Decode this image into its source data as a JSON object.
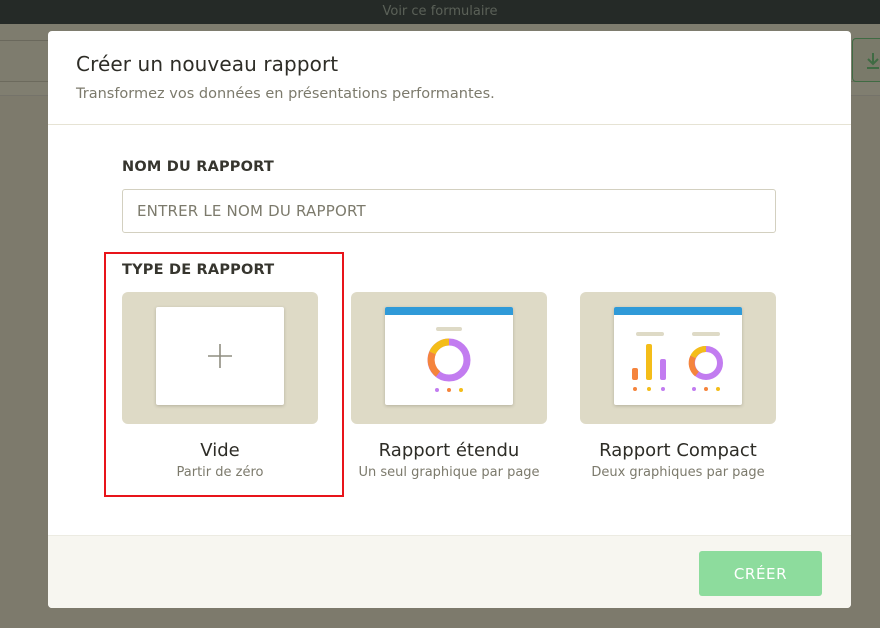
{
  "background": {
    "topbar_text": "Voir ce formulaire"
  },
  "modal": {
    "title": "Créer un nouveau rapport",
    "subtitle": "Transformez vos données en présentations performantes.",
    "name_label": "NOM DU RAPPORT",
    "name_input": {
      "value": "",
      "placeholder": "ENTRER LE NOM DU RAPPORT"
    },
    "type_label": "TYPE DE RAPPORT",
    "report_types": [
      {
        "name": "Vide",
        "description": "Partir de zéro",
        "icon": "plus-icon",
        "selected": true
      },
      {
        "name": "Rapport étendu",
        "description": "Un seul graphique par page",
        "icon": "single-chart-page-icon",
        "selected": false
      },
      {
        "name": "Rapport Compact",
        "description": "Deux graphiques par page",
        "icon": "two-charts-page-icon",
        "selected": false
      }
    ],
    "create_button": "CRÉER"
  },
  "colors": {
    "accent_green": "#8ddc9d",
    "thumbnail_bg": "#dedac6",
    "sheet_header_blue": "#2f9ad8",
    "chart_purple": "#c27cf0",
    "chart_orange": "#f5843c",
    "chart_yellow": "#f4bd19",
    "highlight_red": "#e8141a"
  }
}
